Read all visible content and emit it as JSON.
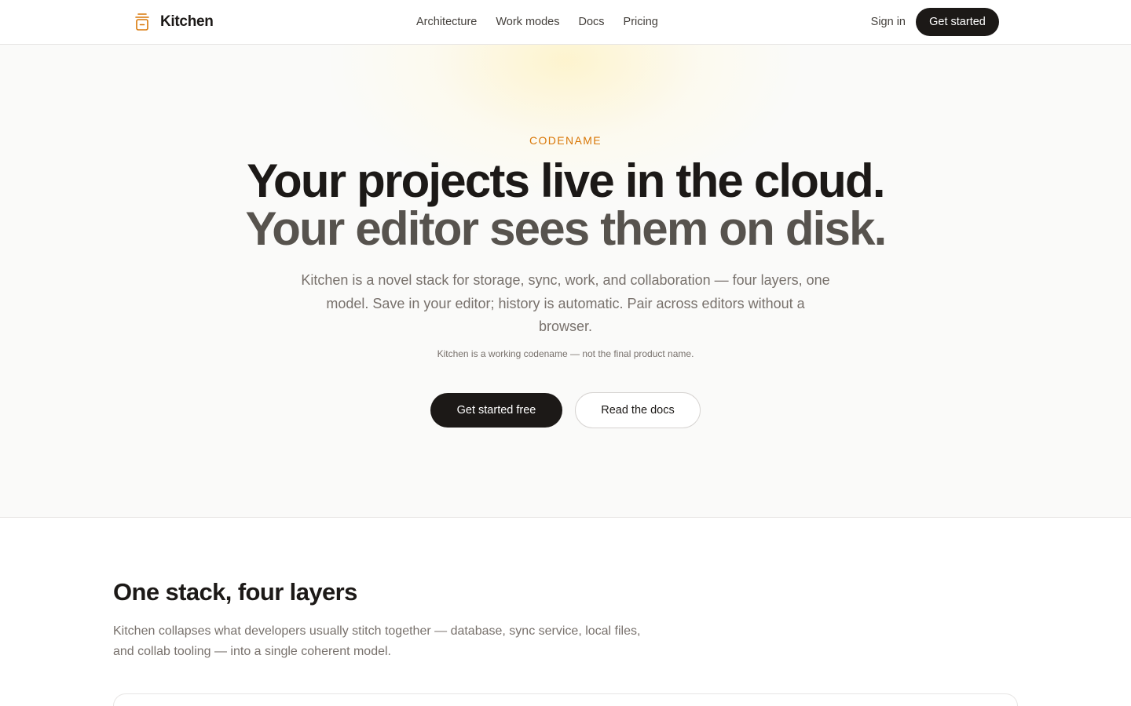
{
  "header": {
    "brand": "Kitchen",
    "brand_icon": "pot-icon",
    "nav": [
      "Architecture",
      "Work modes",
      "Docs",
      "Pricing"
    ],
    "sign_in": "Sign in",
    "cta": "Get started"
  },
  "hero": {
    "eyebrow": "CODENAME",
    "headline_line1": "Your projects live in the cloud.",
    "headline_line2": "Your editor sees them on disk.",
    "lede": "Kitchen is a novel stack for storage, sync, work, and collaboration — four layers, one model. Save in your editor; history is automatic. Pair across editors without a browser.",
    "note": "Kitchen is a working codename — not the final product name.",
    "primary_cta": "Get started free",
    "secondary_cta": "Read the docs"
  },
  "stack": {
    "title": "One stack, four layers",
    "lede": "Kitchen collapses what developers usually stitch together — database, sync service, local files, and collab tooling — into a single coherent model."
  },
  "colors": {
    "accent": "#d97706",
    "ink": "#1c1917",
    "muted": "#78716c",
    "hero_bg": "#fafaf9"
  }
}
